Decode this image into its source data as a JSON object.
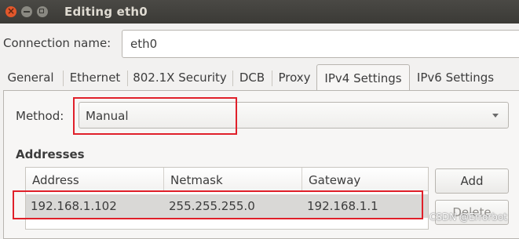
{
  "window": {
    "title": "Editing eth0"
  },
  "connection": {
    "label": "Connection name:",
    "value": "eth0"
  },
  "tabs": [
    {
      "label": "General",
      "active": false
    },
    {
      "label": "Ethernet",
      "active": false
    },
    {
      "label": "802.1X Security",
      "active": false
    },
    {
      "label": "DCB",
      "active": false
    },
    {
      "label": "Proxy",
      "active": false
    },
    {
      "label": "IPv4 Settings",
      "active": true
    },
    {
      "label": "IPv6 Settings",
      "active": false
    }
  ],
  "ipv4": {
    "method_label": "Method:",
    "method_value": "Manual",
    "addresses_heading": "Addresses",
    "columns": [
      "Address",
      "Netmask",
      "Gateway"
    ],
    "rows": [
      [
        "192.168.1.102",
        "255.255.255.0",
        "192.168.1.1"
      ]
    ],
    "add_button": "Add",
    "delete_button": "Delete"
  },
  "watermark": "CSDN @Errorbot",
  "colors": {
    "highlight_box": "#e0202a",
    "titlebar": "#3b3a36",
    "close_button": "#e2572b"
  }
}
